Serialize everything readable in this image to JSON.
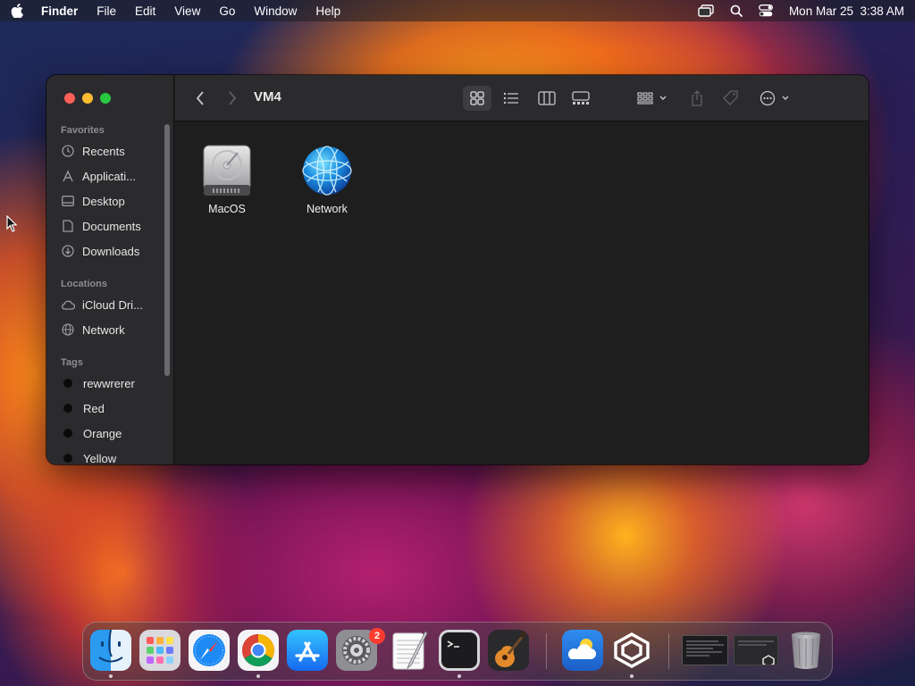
{
  "menubar": {
    "app_name": "Finder",
    "items": [
      "File",
      "Edit",
      "View",
      "Go",
      "Window",
      "Help"
    ],
    "datetime": "Mon Mar 25  3:38 AM"
  },
  "window": {
    "title": "VM4",
    "sidebar": {
      "favorites_label": "Favorites",
      "favorites": [
        "Recents",
        "Applicati...",
        "Desktop",
        "Documents",
        "Downloads"
      ],
      "locations_label": "Locations",
      "locations": [
        "iCloud Dri...",
        "Network"
      ],
      "tags_label": "Tags",
      "tags": [
        "rewwrerer",
        "Red",
        "Orange",
        "Yellow"
      ]
    },
    "files": [
      {
        "name": "MacOS",
        "icon": "hard-drive-icon"
      },
      {
        "name": "Network",
        "icon": "network-globe-icon"
      }
    ]
  },
  "dock": {
    "apps": [
      "Finder",
      "Launchpad",
      "Safari",
      "Google Chrome",
      "App Store",
      "System Settings",
      "TextEdit",
      "Terminal",
      "GarageBand",
      "Weather",
      "Parallels"
    ],
    "system_settings_badge": "2"
  },
  "colors": {
    "close": "#ff5f57",
    "minimize": "#febc2e",
    "maximize": "#28c840",
    "badge": "#ff3b30"
  }
}
